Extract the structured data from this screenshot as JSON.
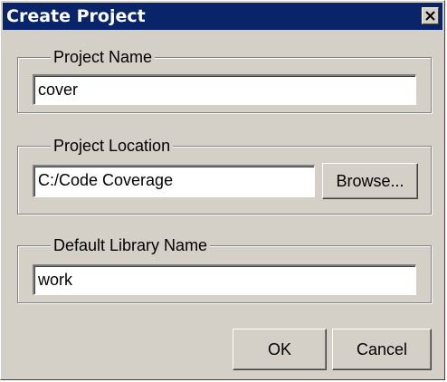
{
  "window": {
    "title": "Create Project",
    "close_icon": "close-icon"
  },
  "project_name": {
    "label": "Project Name",
    "value": "cover"
  },
  "project_location": {
    "label": "Project Location",
    "value": "C:/Code Coverage",
    "browse_label": "Browse..."
  },
  "library": {
    "label": "Default Library Name",
    "value": "work"
  },
  "buttons": {
    "ok_label": "OK",
    "cancel_label": "Cancel"
  },
  "colors": {
    "titlebar": "#0a246a",
    "dialog_face": "#d4d0c8"
  }
}
